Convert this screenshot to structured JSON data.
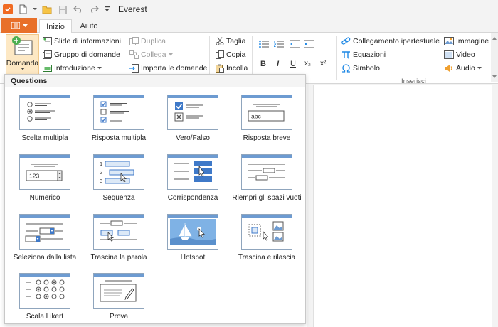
{
  "window": {
    "title": "Everest"
  },
  "tabs": {
    "file": "",
    "home": "Inizio",
    "help": "Aiuto"
  },
  "ribbon": {
    "domanda": "Domanda",
    "slide_info": "Slide di informazioni",
    "question_group": "Gruppo di domande",
    "intro": "Introduzione",
    "duplicate": "Duplica",
    "link": "Collega",
    "import": "Importa le domande",
    "cut": "Taglia",
    "copy": "Copia",
    "paste": "Incolla",
    "bold": "B",
    "italic": "I",
    "underline": "U",
    "subscript": "x₂",
    "superscript": "x²",
    "hyperlink": "Collegamento ipertestuale",
    "equations": "Equazioni",
    "symbol": "Simbolo",
    "image": "Immagine",
    "video": "Video",
    "audio": "Audio",
    "insert_group": "Inserisci"
  },
  "dropdown": {
    "header": "Questions",
    "items": [
      {
        "label": "Scelta multipla",
        "icon": "multiple-choice-icon"
      },
      {
        "label": "Risposta multipla",
        "icon": "multiple-response-icon"
      },
      {
        "label": "Vero/Falso",
        "icon": "true-false-icon"
      },
      {
        "label": "Risposta breve",
        "icon": "short-answer-icon",
        "sample": "abc"
      },
      {
        "label": "Numerico",
        "icon": "numeric-icon",
        "sample": "123"
      },
      {
        "label": "Sequenza",
        "icon": "sequence-icon",
        "numbers": [
          "1",
          "2",
          "3"
        ]
      },
      {
        "label": "Corrispondenza",
        "icon": "matching-icon"
      },
      {
        "label": "Riempri gli spazi vuoti",
        "icon": "fill-in-blanks-icon"
      },
      {
        "label": "Seleziona dalla lista",
        "icon": "select-from-list-icon"
      },
      {
        "label": "Trascina la parola",
        "icon": "drag-words-icon"
      },
      {
        "label": "Hotspot",
        "icon": "hotspot-icon"
      },
      {
        "label": "Trascina e rilascia",
        "icon": "drag-and-drop-icon"
      },
      {
        "label": "Scala Likert",
        "icon": "likert-scale-icon"
      },
      {
        "label": "Prova",
        "icon": "essay-icon"
      }
    ]
  },
  "colors": {
    "accent": "#e8702a",
    "card_header": "#6d9bd1",
    "card_border": "#8fa5bd",
    "selected_button": "#fde8c4"
  }
}
